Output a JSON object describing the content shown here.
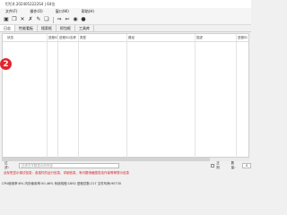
{
  "window": {
    "title": "钉钉4.2024052222S4 | 64位"
  },
  "menu": [
    "文件(F)",
    "操作(O)",
    "窗口(W)",
    "帮助(H)"
  ],
  "toolbar": {
    "icons": [
      "open-icon",
      "copy-icon",
      "close-icon",
      "delete-icon",
      "wrench-icon",
      "copy2-icon",
      "forward-icon",
      "back-icon",
      "record-icon",
      "github-icon"
    ]
  },
  "tabs": [
    "日志",
    "性能看板",
    "搜索框",
    "抓包框",
    "工具库"
  ],
  "table": {
    "columns": [
      "状态",
      "进程ID",
      "进程ID/名称",
      "类型",
      "路径",
      "描述",
      "进程ID"
    ]
  },
  "marker": {
    "number": "2"
  },
  "filter": {
    "label": "过滤：",
    "placeholder": "过滤文字数显示的内容",
    "checkbox_label": "正则",
    "count_label": "数量：",
    "count_value": "0"
  },
  "warning": "此标签显示调试信息：各插件的运行信息、详细信息、有问题请截图发给作者等等提示信息",
  "status": "CPU使用率:8% 内存使用率:50.46% 系统线程:1892 进程总数:217 文件句柄:90730"
}
